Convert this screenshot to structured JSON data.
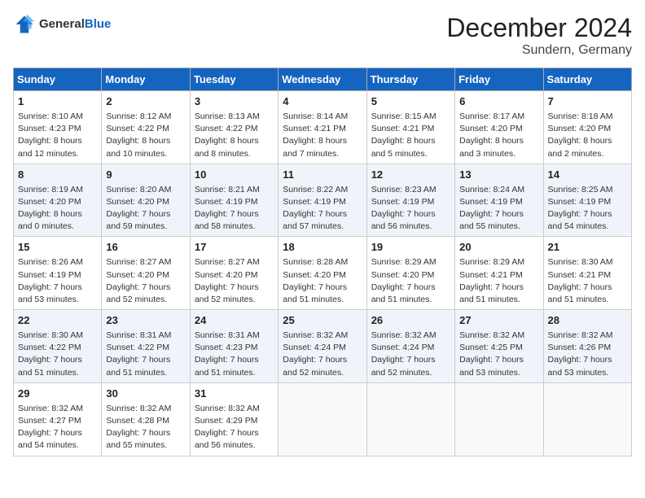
{
  "header": {
    "logo_general": "General",
    "logo_blue": "Blue",
    "month_title": "December 2024",
    "location": "Sundern, Germany"
  },
  "days_of_week": [
    "Sunday",
    "Monday",
    "Tuesday",
    "Wednesday",
    "Thursday",
    "Friday",
    "Saturday"
  ],
  "weeks": [
    [
      {
        "day": "1",
        "sunrise": "8:10 AM",
        "sunset": "4:23 PM",
        "daylight": "8 hours and 12 minutes."
      },
      {
        "day": "2",
        "sunrise": "8:12 AM",
        "sunset": "4:22 PM",
        "daylight": "8 hours and 10 minutes."
      },
      {
        "day": "3",
        "sunrise": "8:13 AM",
        "sunset": "4:22 PM",
        "daylight": "8 hours and 8 minutes."
      },
      {
        "day": "4",
        "sunrise": "8:14 AM",
        "sunset": "4:21 PM",
        "daylight": "8 hours and 7 minutes."
      },
      {
        "day": "5",
        "sunrise": "8:15 AM",
        "sunset": "4:21 PM",
        "daylight": "8 hours and 5 minutes."
      },
      {
        "day": "6",
        "sunrise": "8:17 AM",
        "sunset": "4:20 PM",
        "daylight": "8 hours and 3 minutes."
      },
      {
        "day": "7",
        "sunrise": "8:18 AM",
        "sunset": "4:20 PM",
        "daylight": "8 hours and 2 minutes."
      }
    ],
    [
      {
        "day": "8",
        "sunrise": "8:19 AM",
        "sunset": "4:20 PM",
        "daylight": "8 hours and 0 minutes."
      },
      {
        "day": "9",
        "sunrise": "8:20 AM",
        "sunset": "4:20 PM",
        "daylight": "7 hours and 59 minutes."
      },
      {
        "day": "10",
        "sunrise": "8:21 AM",
        "sunset": "4:19 PM",
        "daylight": "7 hours and 58 minutes."
      },
      {
        "day": "11",
        "sunrise": "8:22 AM",
        "sunset": "4:19 PM",
        "daylight": "7 hours and 57 minutes."
      },
      {
        "day": "12",
        "sunrise": "8:23 AM",
        "sunset": "4:19 PM",
        "daylight": "7 hours and 56 minutes."
      },
      {
        "day": "13",
        "sunrise": "8:24 AM",
        "sunset": "4:19 PM",
        "daylight": "7 hours and 55 minutes."
      },
      {
        "day": "14",
        "sunrise": "8:25 AM",
        "sunset": "4:19 PM",
        "daylight": "7 hours and 54 minutes."
      }
    ],
    [
      {
        "day": "15",
        "sunrise": "8:26 AM",
        "sunset": "4:19 PM",
        "daylight": "7 hours and 53 minutes."
      },
      {
        "day": "16",
        "sunrise": "8:27 AM",
        "sunset": "4:20 PM",
        "daylight": "7 hours and 52 minutes."
      },
      {
        "day": "17",
        "sunrise": "8:27 AM",
        "sunset": "4:20 PM",
        "daylight": "7 hours and 52 minutes."
      },
      {
        "day": "18",
        "sunrise": "8:28 AM",
        "sunset": "4:20 PM",
        "daylight": "7 hours and 51 minutes."
      },
      {
        "day": "19",
        "sunrise": "8:29 AM",
        "sunset": "4:20 PM",
        "daylight": "7 hours and 51 minutes."
      },
      {
        "day": "20",
        "sunrise": "8:29 AM",
        "sunset": "4:21 PM",
        "daylight": "7 hours and 51 minutes."
      },
      {
        "day": "21",
        "sunrise": "8:30 AM",
        "sunset": "4:21 PM",
        "daylight": "7 hours and 51 minutes."
      }
    ],
    [
      {
        "day": "22",
        "sunrise": "8:30 AM",
        "sunset": "4:22 PM",
        "daylight": "7 hours and 51 minutes."
      },
      {
        "day": "23",
        "sunrise": "8:31 AM",
        "sunset": "4:22 PM",
        "daylight": "7 hours and 51 minutes."
      },
      {
        "day": "24",
        "sunrise": "8:31 AM",
        "sunset": "4:23 PM",
        "daylight": "7 hours and 51 minutes."
      },
      {
        "day": "25",
        "sunrise": "8:32 AM",
        "sunset": "4:24 PM",
        "daylight": "7 hours and 52 minutes."
      },
      {
        "day": "26",
        "sunrise": "8:32 AM",
        "sunset": "4:24 PM",
        "daylight": "7 hours and 52 minutes."
      },
      {
        "day": "27",
        "sunrise": "8:32 AM",
        "sunset": "4:25 PM",
        "daylight": "7 hours and 53 minutes."
      },
      {
        "day": "28",
        "sunrise": "8:32 AM",
        "sunset": "4:26 PM",
        "daylight": "7 hours and 53 minutes."
      }
    ],
    [
      {
        "day": "29",
        "sunrise": "8:32 AM",
        "sunset": "4:27 PM",
        "daylight": "7 hours and 54 minutes."
      },
      {
        "day": "30",
        "sunrise": "8:32 AM",
        "sunset": "4:28 PM",
        "daylight": "7 hours and 55 minutes."
      },
      {
        "day": "31",
        "sunrise": "8:32 AM",
        "sunset": "4:29 PM",
        "daylight": "7 hours and 56 minutes."
      },
      null,
      null,
      null,
      null
    ]
  ],
  "labels": {
    "sunrise": "Sunrise:",
    "sunset": "Sunset:",
    "daylight": "Daylight:"
  }
}
